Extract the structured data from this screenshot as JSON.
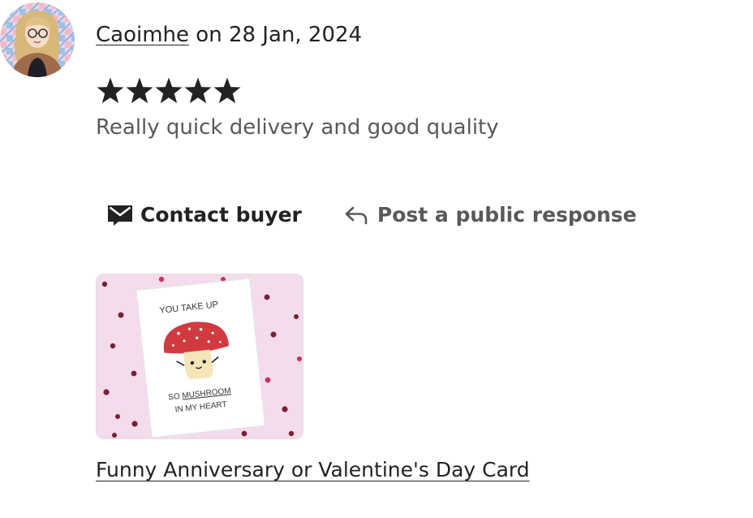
{
  "review": {
    "reviewer_name": "Caoimhe",
    "date_text": " on 28 Jan, 2024",
    "rating": 5,
    "rating_max": 5,
    "text": "Really quick delivery and good quality"
  },
  "actions": {
    "contact_label": "Contact buyer",
    "public_response_label": "Post a public response"
  },
  "product": {
    "title": "Funny Anniversary or Valentine's Day Card",
    "card_text": {
      "line1": "YOU TAKE UP",
      "line2_prefix": "SO ",
      "line2_emphasis": "MUSHROOM",
      "line3": "IN MY HEART"
    }
  },
  "icons": {
    "contact": "envelope-icon",
    "reply": "reply-arrow-icon",
    "star": "star-icon"
  },
  "colors": {
    "text": "#222222",
    "muted_text": "#595959",
    "thumb_background": "#f3dcec",
    "mushroom_cap": "#d33a3f",
    "heart": "#7a1f34"
  }
}
